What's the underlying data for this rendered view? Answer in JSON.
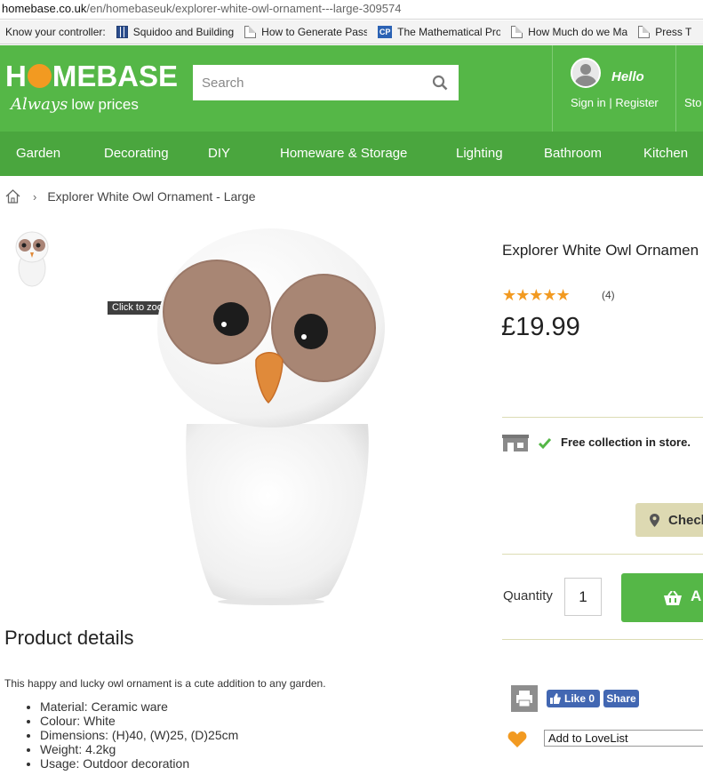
{
  "browser": {
    "url_host": "homebase.co.uk",
    "url_path": "/en/homebaseuk/explorer-white-owl-ornament---large-309574",
    "bookmarks": [
      {
        "label": "Know your controller:",
        "icon": "none"
      },
      {
        "label": "Squidoo and Building",
        "icon": "grid-icon"
      },
      {
        "label": "How to Generate Pass",
        "icon": "page-icon"
      },
      {
        "label": "The Mathematical Pro",
        "icon": "cp-icon"
      },
      {
        "label": "How Much do we Ma",
        "icon": "page-icon"
      },
      {
        "label": "Press T",
        "icon": "page-icon"
      }
    ]
  },
  "header": {
    "logo_pre": "H",
    "logo_post": "MEBASE",
    "tagline_always": "Always",
    "tagline_rest": "low prices",
    "search_placeholder": "Search",
    "hello": "Hello",
    "signin": "Sign in | Register",
    "stores": "Sto"
  },
  "nav": [
    "Garden",
    "Decorating",
    "DIY",
    "Homeware & Storage",
    "Lighting",
    "Bathroom",
    "Kitchen"
  ],
  "breadcrumb": {
    "current": "Explorer White Owl Ornament - Large"
  },
  "gallery": {
    "zoom_tip": "Click to zoom"
  },
  "product": {
    "title": "Explorer White Owl Ornamen",
    "stars": "★★★★★",
    "rating": 5,
    "reviews": "(4)",
    "price": "£19.99",
    "free_collection": "Free collection in store.",
    "check_button": "Check",
    "quantity_label": "Quantity",
    "quantity_value": "1",
    "add_button": "A",
    "fb_like": "Like 0",
    "fb_share": "Share",
    "lovelist": "Add to LoveList"
  },
  "details": {
    "title": "Product details",
    "description": "This happy and lucky owl ornament is a cute addition to any garden.",
    "bullets": [
      "Material: Ceramic ware",
      "Colour: White",
      "Dimensions: (H)40, (W)25, (D)25cm",
      "Weight: 4.2kg",
      "Usage: Outdoor decoration"
    ]
  },
  "colors": {
    "brand_green": "#55b747",
    "nav_green": "#4aa63e",
    "accent_orange": "#f29a21",
    "check_button_bg": "#ddd9b2",
    "facebook_blue": "#4267b2"
  }
}
